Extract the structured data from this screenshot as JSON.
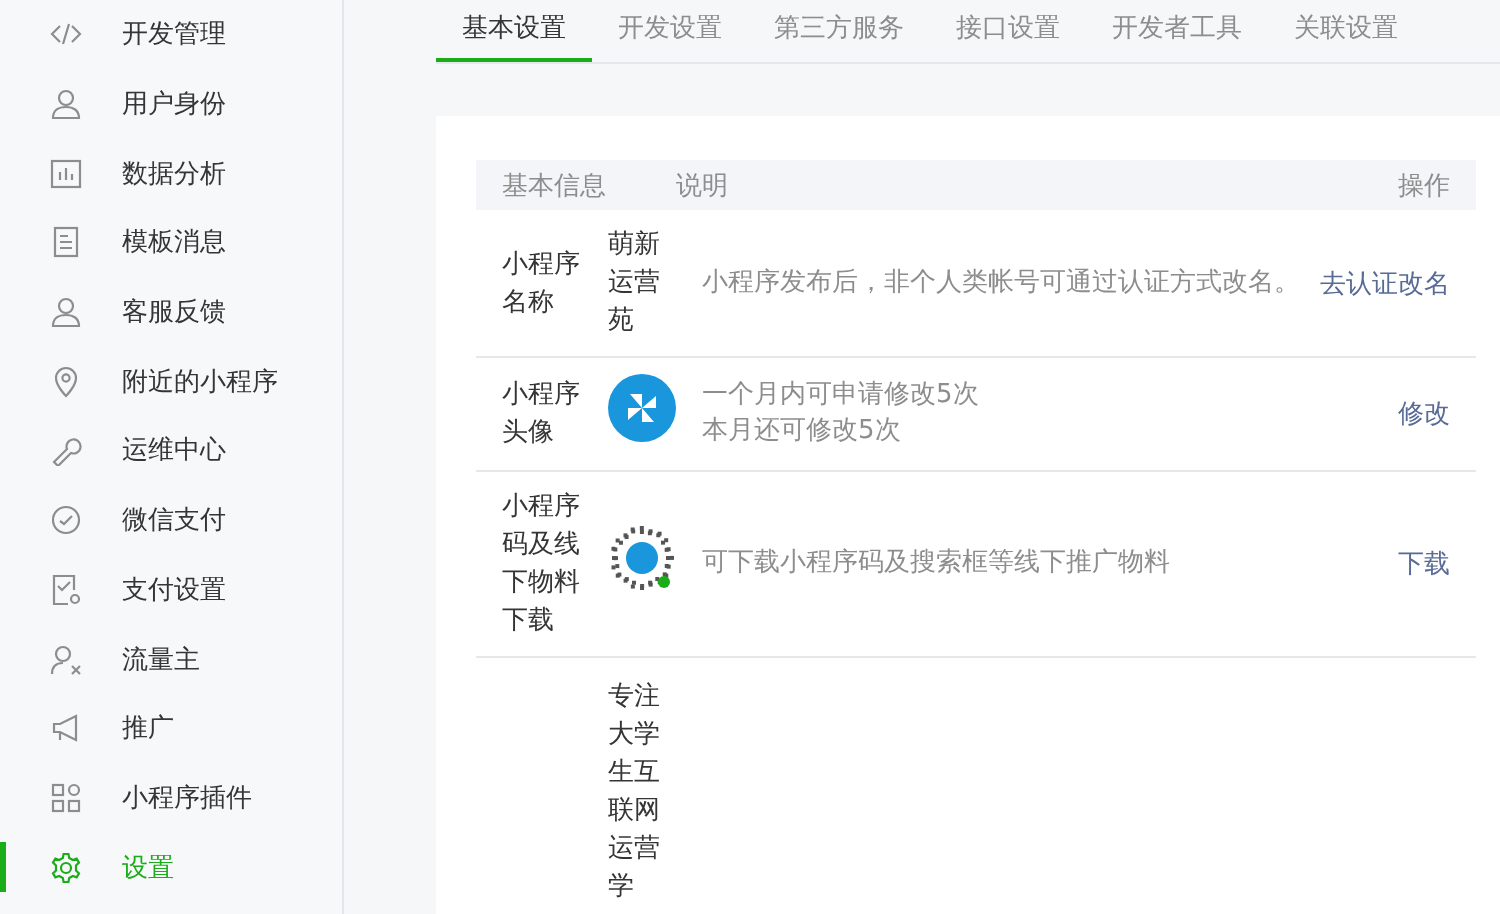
{
  "sidebar": {
    "items": [
      {
        "label": "开发管理",
        "selected": false
      },
      {
        "label": "用户身份",
        "selected": false
      },
      {
        "label": "数据分析",
        "selected": false
      },
      {
        "label": "模板消息",
        "selected": false
      },
      {
        "label": "客服反馈",
        "selected": false
      },
      {
        "label": "附近的小程序",
        "selected": false
      },
      {
        "label": "运维中心",
        "selected": false
      },
      {
        "label": "微信支付",
        "selected": false
      },
      {
        "label": "支付设置",
        "selected": false
      },
      {
        "label": "流量主",
        "selected": false
      },
      {
        "label": "推广",
        "selected": false
      },
      {
        "label": "小程序插件",
        "selected": false
      },
      {
        "label": "设置",
        "selected": true
      }
    ]
  },
  "tabs": [
    {
      "label": "基本设置",
      "selected": true
    },
    {
      "label": "开发设置",
      "selected": false
    },
    {
      "label": "第三方服务",
      "selected": false
    },
    {
      "label": "接口设置",
      "selected": false
    },
    {
      "label": "开发者工具",
      "selected": false
    },
    {
      "label": "关联设置",
      "selected": false
    }
  ],
  "table": {
    "columns": [
      "基本信息",
      "说明",
      "操作"
    ],
    "rows": [
      {
        "label": "小程序名称",
        "kind": "text",
        "value": "萌新运营苑",
        "description": [
          "小程序发布后，非个人类帐号可通过认证方式改名。"
        ],
        "action": "去认证改名"
      },
      {
        "label": "小程序头像",
        "kind": "avatar",
        "description": [
          "一个月内可申请修改5次",
          "本月还可修改5次"
        ],
        "action": "修改"
      },
      {
        "label": "小程序码及线下物料下载",
        "kind": "code",
        "description": [
          "可下载小程序码及搜索框等线下推广物料"
        ],
        "action": "下载"
      },
      {
        "kind": "text",
        "value": "专注大学生互联网运营学"
      }
    ]
  }
}
